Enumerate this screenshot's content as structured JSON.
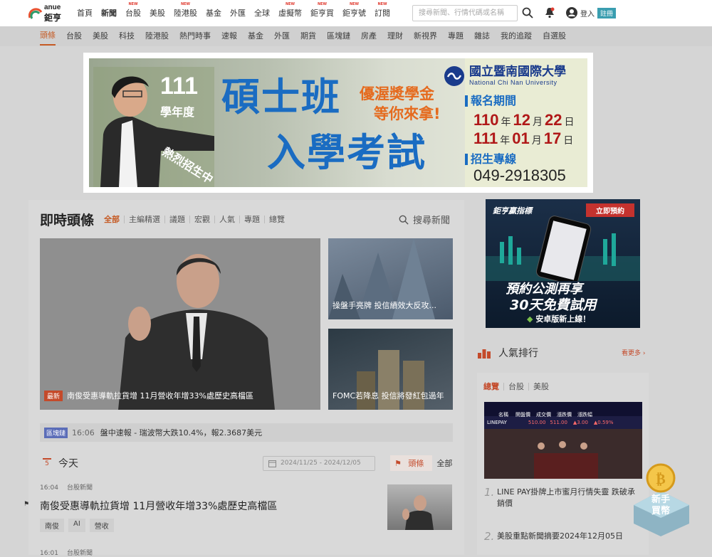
{
  "header": {
    "logo_en": "anue",
    "logo_zh": "鉅亨",
    "nav": [
      {
        "label": "首頁",
        "new": false,
        "active": false
      },
      {
        "label": "新聞",
        "new": false,
        "active": true
      },
      {
        "label": "台股",
        "new": true,
        "active": false
      },
      {
        "label": "美股",
        "new": false,
        "active": false
      },
      {
        "label": "陸港股",
        "new": true,
        "active": false
      },
      {
        "label": "基金",
        "new": false,
        "active": false
      },
      {
        "label": "外匯",
        "new": false,
        "active": false
      },
      {
        "label": "全球",
        "new": false,
        "active": false
      },
      {
        "label": "虛擬幣",
        "new": true,
        "active": false
      },
      {
        "label": "鉅亨買",
        "new": true,
        "active": false
      },
      {
        "label": "鉅亨號",
        "new": true,
        "active": false
      },
      {
        "label": "訂閱",
        "new": true,
        "active": false
      }
    ],
    "new_badge": "NEW",
    "search_placeholder": "搜尋新聞、行情代碼或名稱",
    "login": "登入",
    "register": "註冊"
  },
  "subnav": [
    "頭條",
    "台股",
    "美股",
    "科技",
    "陸港股",
    "熱門時事",
    "速報",
    "基金",
    "外匯",
    "期貨",
    "區塊鏈",
    "房產",
    "理財",
    "新視界",
    "專題",
    "雜誌",
    "我的追蹤",
    "自選股"
  ],
  "banner": {
    "year": "111",
    "grade": "學年度",
    "line1": "碩士班",
    "line2": "入學考試",
    "hot": "熱烈招生中",
    "scholarship1": "優渥獎學金",
    "scholarship2": "等你來拿!",
    "uni_zh": "國立暨南國際大學",
    "uni_en": "National Chi Nan University",
    "period_label": "報名期間",
    "date1": {
      "y": "110",
      "m": "12",
      "d": "22"
    },
    "date2": {
      "y": "111",
      "m": "01",
      "d": "17"
    },
    "y_unit": "年",
    "m_unit": "月",
    "d_unit": "日",
    "hotline_label": "招生專線",
    "phone": "049-2918305"
  },
  "headlines": {
    "title": "即時頭條",
    "tabs": [
      "全部",
      "主編精選",
      "議題",
      "宏觀",
      "人氣",
      "專題",
      "總覽"
    ],
    "search": "搜尋新聞",
    "hero_tag": "最新",
    "hero_caption": "南俊受惠導軌拉貨增 11月營收年增33%處歷史高檔區",
    "thumb1": "操盤手亮牌 投信績效大反攻...",
    "thumb2": "FOMC若降息 投信將發紅包過年",
    "ticker_tag": "區塊鏈",
    "ticker_time": "16:06",
    "ticker_text": "盤中速報 - 瑞波幣大跌10.4%，報2.3687美元"
  },
  "today": {
    "day": "5",
    "label": "今天",
    "daterange": "2024/11/25 - 2024/12/05",
    "filter_on": "頭條",
    "filter_all": "全部",
    "news": [
      {
        "time": "16:04",
        "cat": "台股新聞",
        "title": "南俊受惠導軌拉貨增 11月營收年增33%處歷史高檔區",
        "tags": [
          "南俊",
          "AI",
          "營收"
        ]
      },
      {
        "time": "16:01",
        "cat": "台股新聞"
      }
    ]
  },
  "ad": {
    "brand": "鉅亨贏指標",
    "preorder": "立即預約",
    "line1": "預約公測再享",
    "line2": "30天免費試用",
    "line3": "安卓版新上線！"
  },
  "ranking": {
    "title": "人氣排行",
    "more": "看更多",
    "tabs": [
      "總覽",
      "台股",
      "美股"
    ],
    "board": {
      "h": [
        "名稱",
        "開盤價",
        "成交價",
        "漲跌價",
        "漲跌幅"
      ],
      "row": [
        "LINEPAY",
        "510.00",
        "511.00",
        "▲3.00",
        "▲0.59%"
      ]
    },
    "items": [
      {
        "n": "1.",
        "text": "LINE PAY掛牌上市蜜月行情失靈 跌破承銷價"
      },
      {
        "n": "2.",
        "text": "美股重點新聞摘要2024年12月05日"
      }
    ]
  },
  "coin": {
    "l1": "新手",
    "l2": "買幣"
  },
  "colors": {
    "accent": "#c55a24",
    "brand_blue": "#1a6cc2",
    "red": "#b01818"
  }
}
